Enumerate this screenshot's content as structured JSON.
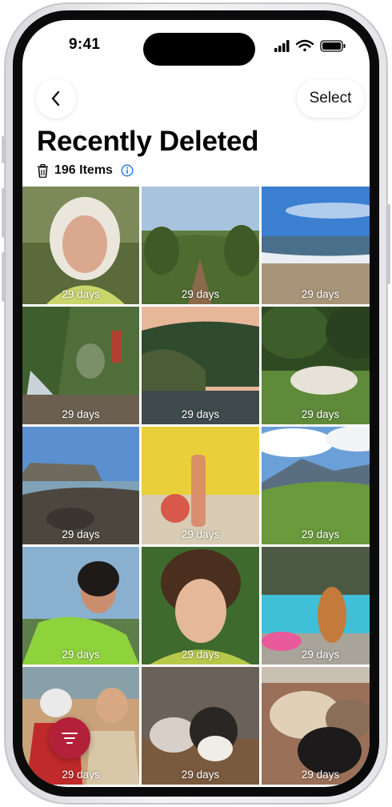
{
  "status_bar": {
    "time": "9:41"
  },
  "header": {
    "back_icon": "chevron-left-icon",
    "select_label": "Select",
    "title": "Recently Deleted",
    "item_count": "196 Items",
    "trash_icon": "trash-icon",
    "info_icon": "info-icon"
  },
  "photos": [
    {
      "subject": "older woman portrait",
      "days": "29 days"
    },
    {
      "subject": "vineyard rows",
      "days": "29 days"
    },
    {
      "subject": "ocean beach",
      "days": "29 days"
    },
    {
      "subject": "people by waterfall",
      "days": "29 days"
    },
    {
      "subject": "forested hills at dusk",
      "days": "29 days"
    },
    {
      "subject": "shaggy dog in park",
      "days": "29 days"
    },
    {
      "subject": "rocky shoreline",
      "days": "29 days"
    },
    {
      "subject": "peach and bottle",
      "days": "29 days"
    },
    {
      "subject": "mountain meadow",
      "days": "29 days"
    },
    {
      "subject": "woman in green sweater",
      "days": "29 days"
    },
    {
      "subject": "curly-haired man portrait",
      "days": "29 days"
    },
    {
      "subject": "dog by pool",
      "days": "29 days"
    },
    {
      "subject": "older couple",
      "days": "29 days"
    },
    {
      "subject": "kitten",
      "days": "29 days"
    },
    {
      "subject": "sleeping kittens",
      "days": "29 days"
    }
  ],
  "filter_button": {
    "icon": "filter-icon"
  },
  "colors": {
    "accent": "#1d72f2",
    "fab": "#b3203a"
  }
}
